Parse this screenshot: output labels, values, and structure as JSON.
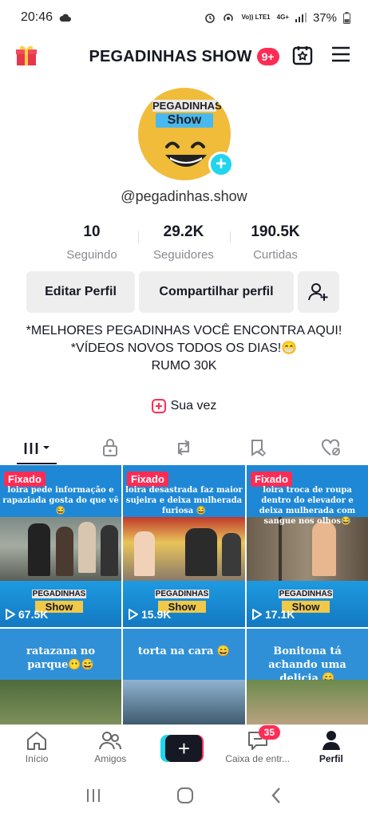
{
  "status_bar": {
    "time": "20:46",
    "network_volte": "Vo)) LTE1",
    "network_gen": "4G+",
    "battery": "37%"
  },
  "header": {
    "title": "PEGADINHAS SHOW",
    "badge": "9+"
  },
  "profile": {
    "avatar_text_1": "PEGADINHAS",
    "avatar_text_2": "Show",
    "username": "@pegadinhas.show",
    "stats": [
      {
        "value": "10",
        "label": "Seguindo"
      },
      {
        "value": "29.2K",
        "label": "Seguidores"
      },
      {
        "value": "190.5K",
        "label": "Curtidas"
      }
    ],
    "edit_label": "Editar Perfil",
    "share_label": "Compartilhar perfil",
    "bio": [
      "*MELHORES PEGADINHAS VOCÊ ENCONTRA AQUI!",
      "*VÍDEOS NOVOS TODOS OS DIAS!😁",
      "RUMO 30K"
    ],
    "sua_vez": "Sua vez"
  },
  "videos": [
    {
      "pinned": "Fixado",
      "caption": "loira pede informação e rapaziada gosta do que vê 😂",
      "views": "67.5K",
      "logo1": "PEGADINHAS",
      "logo2": "Show"
    },
    {
      "pinned": "Fixado",
      "caption": "loira desastrada faz maior sujeira e deixa mulherada furiosa 😂",
      "views": "15.9K",
      "logo1": "PEGADINHAS",
      "logo2": "Show"
    },
    {
      "pinned": "Fixado",
      "caption": "loira troca de roupa dentro do elevador e deixa mulherada com sangue nos olhos😂",
      "views": "17.1K",
      "logo1": "PEGADINHAS",
      "logo2": "Show"
    },
    {
      "caption": "ratazana no parque😶😅"
    },
    {
      "caption": "torta na cara 😄"
    },
    {
      "caption": "Bonitona tá achando uma delicia 😄"
    }
  ],
  "bottom_nav": {
    "home": "Início",
    "friends": "Amigos",
    "inbox": "Caixa de entr...",
    "inbox_badge": "35",
    "profile": "Perfil"
  },
  "colors": {
    "accent": "#fe2c55",
    "cyan": "#20d5ec",
    "tile_blue": "#1e88d6"
  }
}
